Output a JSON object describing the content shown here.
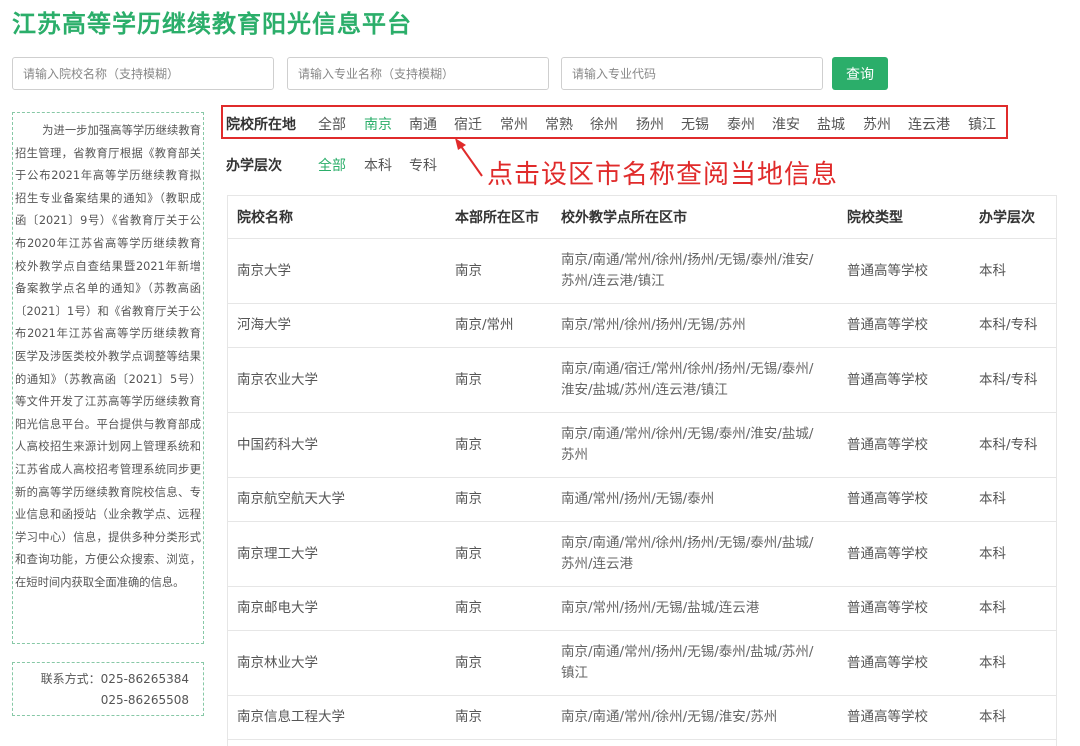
{
  "header": {
    "title": "江苏高等学历继续教育阳光信息平台"
  },
  "search": {
    "school_placeholder": "请输入院校名称（支持模糊）",
    "major_placeholder": "请输入专业名称（支持模糊）",
    "code_placeholder": "请输入专业代码",
    "button_label": "查询"
  },
  "sidebar": {
    "intro": "为进一步加强高等学历继续教育招生管理，省教育厅根据《教育部关于公布2021年高等学历继续教育拟招生专业备案结果的通知》（教职成函〔2021〕9号）《省教育厅关于公布2020年江苏省高等学历继续教育校外教学点自查结果暨2021年新增备案教学点名单的通知》（苏教高函〔2021〕1号）和《省教育厅关于公布2021年江苏省高等学历继续教育医学及涉医类校外教学点调整等结果的通知》（苏教高函〔2021〕5号）等文件开发了江苏高等学历继续教育阳光信息平台。平台提供与教育部成人高校招生来源计划网上管理系统和江苏省成人高校招考管理系统同步更新的高等学历继续教育院校信息、专业信息和函授站（业余教学点、远程学习中心）信息，提供多种分类形式和查询功能，方便公众搜索、浏览，在短时间内获取全面准确的信息。",
    "contact_label": "联系方式：025-86265384",
    "contact_phone2": "025-86265508"
  },
  "filters": {
    "region_label": "院校所在地",
    "regions": [
      "全部",
      "南京",
      "南通",
      "宿迁",
      "常州",
      "常熟",
      "徐州",
      "扬州",
      "无锡",
      "泰州",
      "淮安",
      "盐城",
      "苏州",
      "连云港",
      "镇江"
    ],
    "region_selected": "南京",
    "level_label": "办学层次",
    "levels": [
      "全部",
      "本科",
      "专科"
    ],
    "level_selected": "全部"
  },
  "annotation": {
    "text": "点击设区市名称查阅当地信息",
    "color": "#e02b2b"
  },
  "table": {
    "headers": [
      "院校名称",
      "本部所在区市",
      "校外教学点所在区市",
      "院校类型",
      "办学层次"
    ],
    "rows": [
      [
        "南京大学",
        "南京",
        "南京/南通/常州/徐州/扬州/无锡/泰州/淮安/苏州/连云港/镇江",
        "普通高等学校",
        "本科"
      ],
      [
        "河海大学",
        "南京/常州",
        "南京/常州/徐州/扬州/无锡/苏州",
        "普通高等学校",
        "本科/专科"
      ],
      [
        "南京农业大学",
        "南京",
        "南京/南通/宿迁/常州/徐州/扬州/无锡/泰州/淮安/盐城/苏州/连云港/镇江",
        "普通高等学校",
        "本科/专科"
      ],
      [
        "中国药科大学",
        "南京",
        "南京/南通/常州/徐州/无锡/泰州/淮安/盐城/苏州",
        "普通高等学校",
        "本科/专科"
      ],
      [
        "南京航空航天大学",
        "南京",
        "南通/常州/扬州/无锡/泰州",
        "普通高等学校",
        "本科"
      ],
      [
        "南京理工大学",
        "南京",
        "南京/南通/常州/徐州/扬州/无锡/泰州/盐城/苏州/连云港",
        "普通高等学校",
        "本科"
      ],
      [
        "南京邮电大学",
        "南京",
        "南京/常州/扬州/无锡/盐城/连云港",
        "普通高等学校",
        "本科"
      ],
      [
        "南京林业大学",
        "南京",
        "南京/南通/常州/扬州/无锡/泰州/盐城/苏州/镇江",
        "普通高等学校",
        "本科"
      ],
      [
        "南京信息工程大学",
        "南京",
        "南京/南通/常州/徐州/无锡/淮安/苏州",
        "普通高等学校",
        "本科"
      ]
    ]
  },
  "colors": {
    "brand_green": "#2bae6a",
    "highlight_red": "#e02b2b"
  }
}
